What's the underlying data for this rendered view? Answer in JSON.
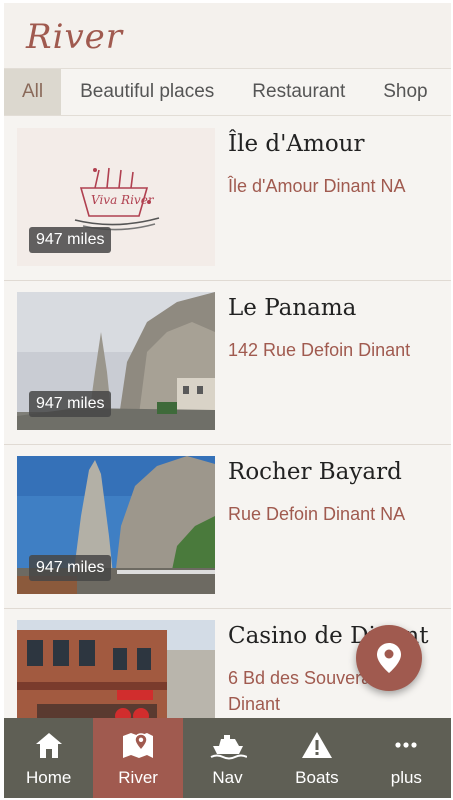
{
  "header": {
    "title": "River"
  },
  "tabs": [
    {
      "label": "All",
      "active": true
    },
    {
      "label": "Beautiful places",
      "active": false
    },
    {
      "label": "Restaurant",
      "active": false
    },
    {
      "label": "Shop",
      "active": false
    }
  ],
  "places": [
    {
      "name": "Île d'Amour",
      "address": "Île d'Amour Dinant NA",
      "distance": "947 miles",
      "image": "viva-river-logo",
      "logo_text": "Viva River"
    },
    {
      "name": "Le Panama",
      "address": "142 Rue Defoin Dinant",
      "distance": "947 miles",
      "image": "rock-cliff-road-photo"
    },
    {
      "name": "Rocher Bayard",
      "address": "Rue Defoin Dinant NA",
      "distance": "947 miles",
      "image": "rock-needle-photo"
    },
    {
      "name": "Casino de Dinant",
      "address": "6 Bd des Souverains Dinant",
      "distance": "",
      "image": "casino-building-photo"
    }
  ],
  "fab": {
    "icon": "map-pin-icon"
  },
  "bottom_nav": [
    {
      "label": "Home",
      "icon": "home-icon",
      "active": false
    },
    {
      "label": "River",
      "icon": "map-icon",
      "active": true
    },
    {
      "label": "Nav",
      "icon": "boat-icon",
      "active": false
    },
    {
      "label": "Boats",
      "icon": "warning-icon",
      "active": false
    },
    {
      "label": "plus",
      "icon": "more-icon",
      "active": false
    }
  ],
  "colors": {
    "accent": "#a05a4f",
    "nav_bg": "#5f5f55",
    "bg": "#f6f4f1"
  }
}
